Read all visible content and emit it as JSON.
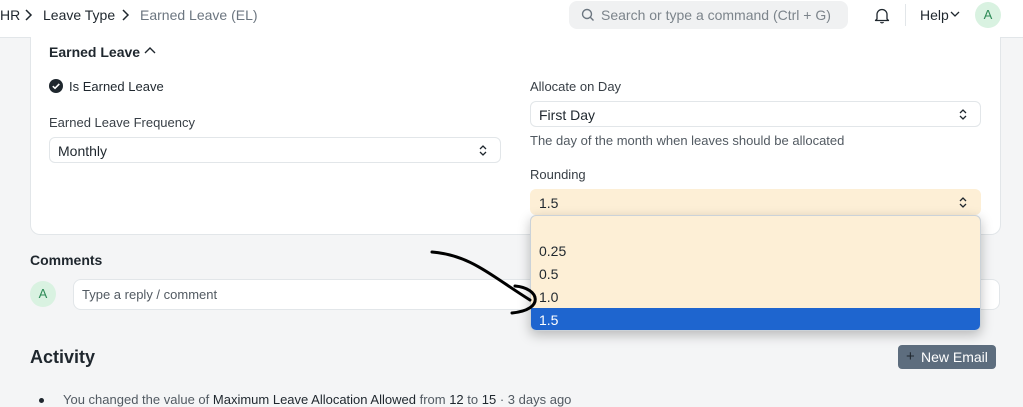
{
  "breadcrumb": {
    "items": [
      "HR",
      "Leave Type",
      "Earned Leave (EL)"
    ]
  },
  "search": {
    "placeholder": "Search or type a command (Ctrl + G)"
  },
  "navbar": {
    "help_label": "Help",
    "avatar_initial": "A",
    "icons": [
      "search-icon",
      "bell-icon",
      "chevron-down-icon"
    ]
  },
  "section": {
    "title": "Earned Leave",
    "is_earned_leave_label": "Is Earned Leave",
    "is_earned_leave_checked": true,
    "frequency_label": "Earned Leave Frequency",
    "frequency_value": "Monthly",
    "allocate_label": "Allocate on Day",
    "allocate_value": "First Day",
    "allocate_help": "The day of the month when leaves should be allocated",
    "rounding_label": "Rounding",
    "rounding_value": "1.5"
  },
  "rounding_dropdown": {
    "options": [
      "",
      "0.25",
      "0.5",
      "1.0",
      "1.5"
    ],
    "selected_index": 4
  },
  "comments": {
    "title": "Comments",
    "avatar_initial": "A",
    "placeholder": "Type a reply / comment"
  },
  "activity": {
    "title": "Activity",
    "new_email_label": "New Email",
    "entry": {
      "prefix": "You changed the value of",
      "field": "Maximum Leave Allocation Allowed",
      "from_word": "from",
      "old_value": "12",
      "to_word": "to",
      "new_value": "15",
      "time": "· 3 days ago"
    }
  },
  "colors": {
    "accent_blue": "#1e65cf",
    "dropdown_bg": "#fdefd6",
    "new_email_bg": "#5d6d7e",
    "avatar_bg": "#d9f2e1"
  }
}
